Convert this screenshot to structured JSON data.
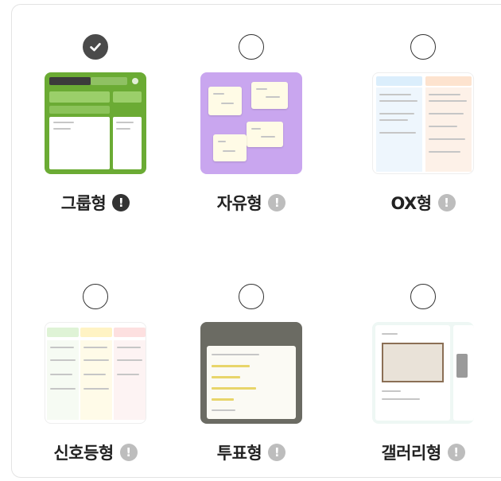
{
  "layouts": [
    {
      "label": "그룹형",
      "selected": true,
      "info_icon": "exclamation-circle-icon"
    },
    {
      "label": "자유형",
      "selected": false,
      "info_icon": "exclamation-circle-icon"
    },
    {
      "label": "OX형",
      "selected": false,
      "info_icon": "exclamation-circle-icon"
    },
    {
      "label": "신호등형",
      "selected": false,
      "info_icon": "exclamation-circle-icon"
    },
    {
      "label": "투표형",
      "selected": false,
      "info_icon": "exclamation-circle-icon"
    },
    {
      "label": "갤러리형",
      "selected": false,
      "info_icon": "exclamation-circle-icon"
    }
  ],
  "info_glyph": "!",
  "colors": {
    "group": "#6bab34",
    "free": "#c9a6ef",
    "check": "#4a4a4a",
    "info_active": "#333333",
    "info_inactive": "#bdbdbd"
  }
}
